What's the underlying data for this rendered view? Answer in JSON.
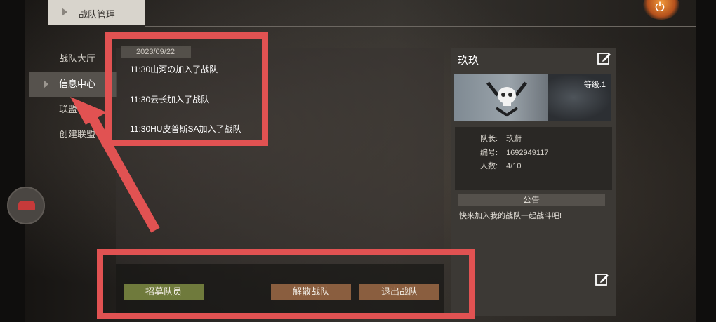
{
  "header": {
    "title": "战队管理"
  },
  "nav": {
    "items": [
      {
        "label": "战队大厅"
      },
      {
        "label": "信息中心"
      },
      {
        "label": "联盟"
      },
      {
        "label": "创建联盟"
      }
    ]
  },
  "messages": {
    "date": "2023/09/22",
    "entries": [
      {
        "text": "11:30山河の加入了战队"
      },
      {
        "text": "11:30云长加入了战队"
      },
      {
        "text": "11:30HU皮普斯SA加入了战队"
      }
    ]
  },
  "actions": {
    "recruit": "招募队员",
    "dissolve": "解散战队",
    "quit": "退出战队"
  },
  "team": {
    "name": "玖玖",
    "level": "等级.1",
    "captain_label": "队长:",
    "captain_value": "玖蔚",
    "id_label": "编号:",
    "id_value": "1692949117",
    "members_label": "人数:",
    "members_value": "4/10",
    "notice_title": "公告",
    "notice_text": "快来加入我的战队一起战斗吧!"
  },
  "colors": {
    "highlight": "#e15252",
    "recruit_button": "#6f7a3c",
    "danger_button": "#8a5e3f"
  },
  "icons": [
    "power-icon",
    "edit-icon",
    "skull-emblem",
    "chevron-right-icon",
    "chat-icon"
  ]
}
